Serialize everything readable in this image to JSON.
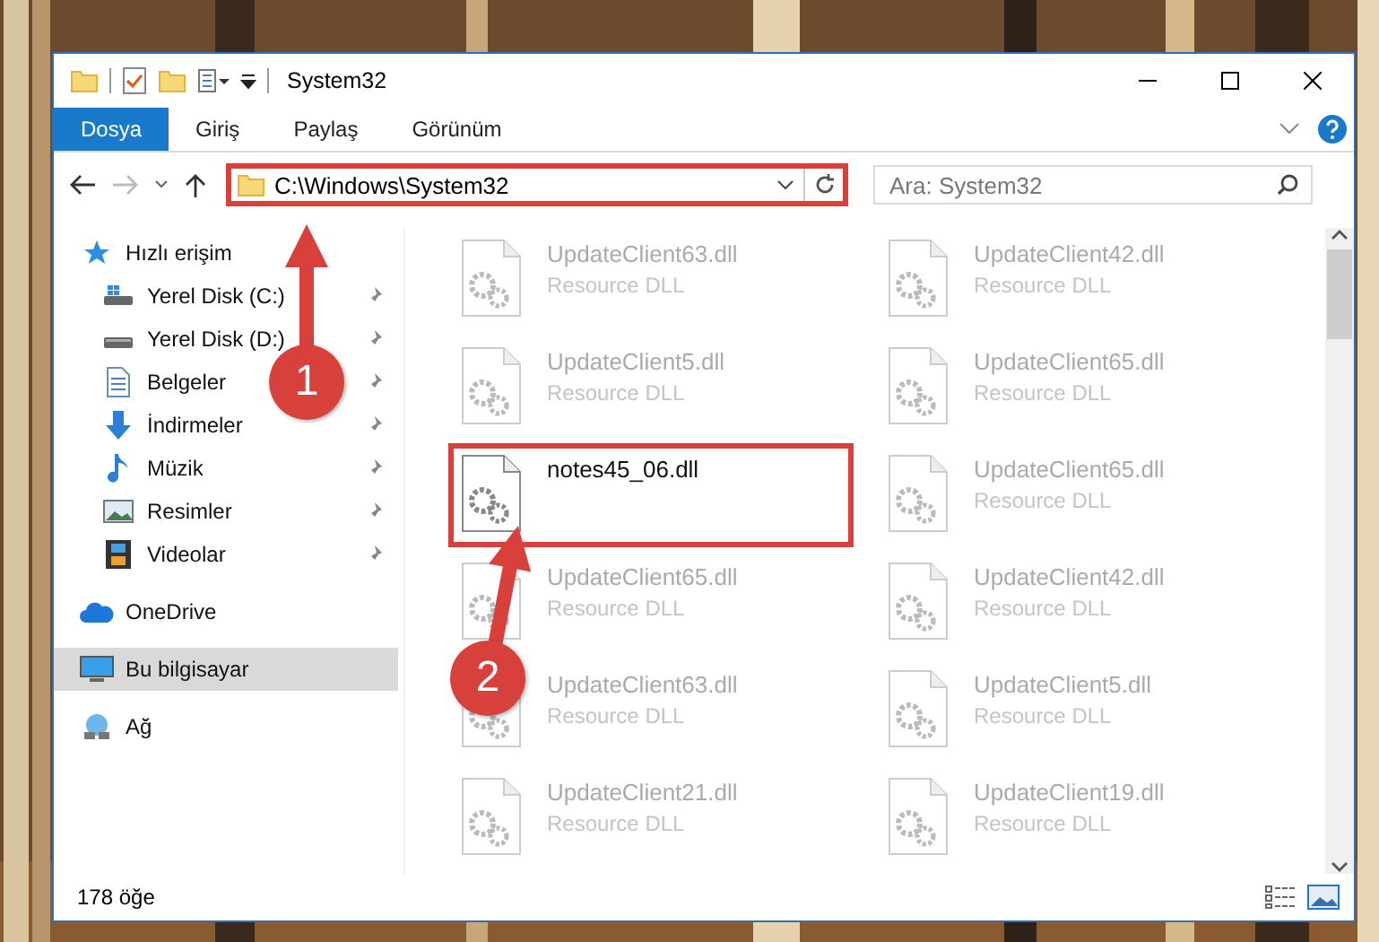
{
  "window": {
    "title": "System32"
  },
  "ribbon_tabs": [
    {
      "label": "Dosya",
      "selected": true
    },
    {
      "label": "Giriş",
      "selected": false
    },
    {
      "label": "Paylaş",
      "selected": false
    },
    {
      "label": "Görünüm",
      "selected": false
    }
  ],
  "address": {
    "value": "C:\\Windows\\System32",
    "highlighted": true
  },
  "search": {
    "placeholder": "Ara: System32"
  },
  "nav": [
    {
      "label": "Hızlı erişim",
      "kind": "star",
      "selected": false,
      "children": [
        {
          "label": "Yerel Disk (C:)",
          "kind": "system-drive",
          "pinned": true,
          "selected": false
        },
        {
          "label": "Yerel Disk (D:)",
          "kind": "drive",
          "pinned": true,
          "selected": false
        },
        {
          "label": "Belgeler",
          "kind": "document",
          "pinned": true,
          "selected": false
        },
        {
          "label": "İndirmeler",
          "kind": "download",
          "pinned": true,
          "selected": false
        },
        {
          "label": "Müzik",
          "kind": "music",
          "pinned": true,
          "selected": false
        },
        {
          "label": "Resimler",
          "pinned": true,
          "selected": false
        },
        {
          "label": "Videolar",
          "kind": "film",
          "pinned": true,
          "selected": false
        }
      ]
    },
    {
      "label": "OneDrive",
      "kind": "cloud",
      "selected": false
    },
    {
      "label": "Bu bilgisayar",
      "kind": "computer",
      "selected": true
    },
    {
      "label": "Ağ",
      "kind": "network",
      "selected": false
    }
  ],
  "files": [
    {
      "name": "UpdateClient63.dll",
      "type": "Resource DLL",
      "blurred": true,
      "highlighted": false
    },
    {
      "name": "UpdateClient42.dll",
      "type": "Resource DLL",
      "blurred": true,
      "highlighted": false
    },
    {
      "name": "UpdateClient5.dll",
      "type": "Resource DLL",
      "blurred": true,
      "highlighted": false
    },
    {
      "name": "UpdateClient65.dll",
      "type": "Resource DLL",
      "blurred": true,
      "highlighted": false
    },
    {
      "name": "notes45_06.dll",
      "blurred": false,
      "highlighted": true
    },
    {
      "name": "UpdateClient65.dll",
      "type": "Resource DLL",
      "blurred": true,
      "highlighted": false
    },
    {
      "name": "UpdateClient65.dll",
      "type": "Resource DLL",
      "blurred": true,
      "highlighted": false
    },
    {
      "name": "UpdateClient42.dll",
      "type": "Resource DLL",
      "blurred": true,
      "highlighted": false
    },
    {
      "name": "UpdateClient63.dll",
      "type": "Resource DLL",
      "blurred": true,
      "highlighted": false
    },
    {
      "name": "UpdateClient5.dll",
      "type": "Resource DLL",
      "blurred": true,
      "highlighted": false
    },
    {
      "name": "UpdateClient21.dll",
      "type": "Resource DLL",
      "blurred": true,
      "highlighted": false
    },
    {
      "name": "UpdateClient19.dll",
      "type": "Resource DLL",
      "blurred": true,
      "highlighted": false
    }
  ],
  "callouts": [
    {
      "label": "1"
    },
    {
      "label": "2"
    }
  ],
  "status_bar": {
    "count": "178 öğe"
  }
}
